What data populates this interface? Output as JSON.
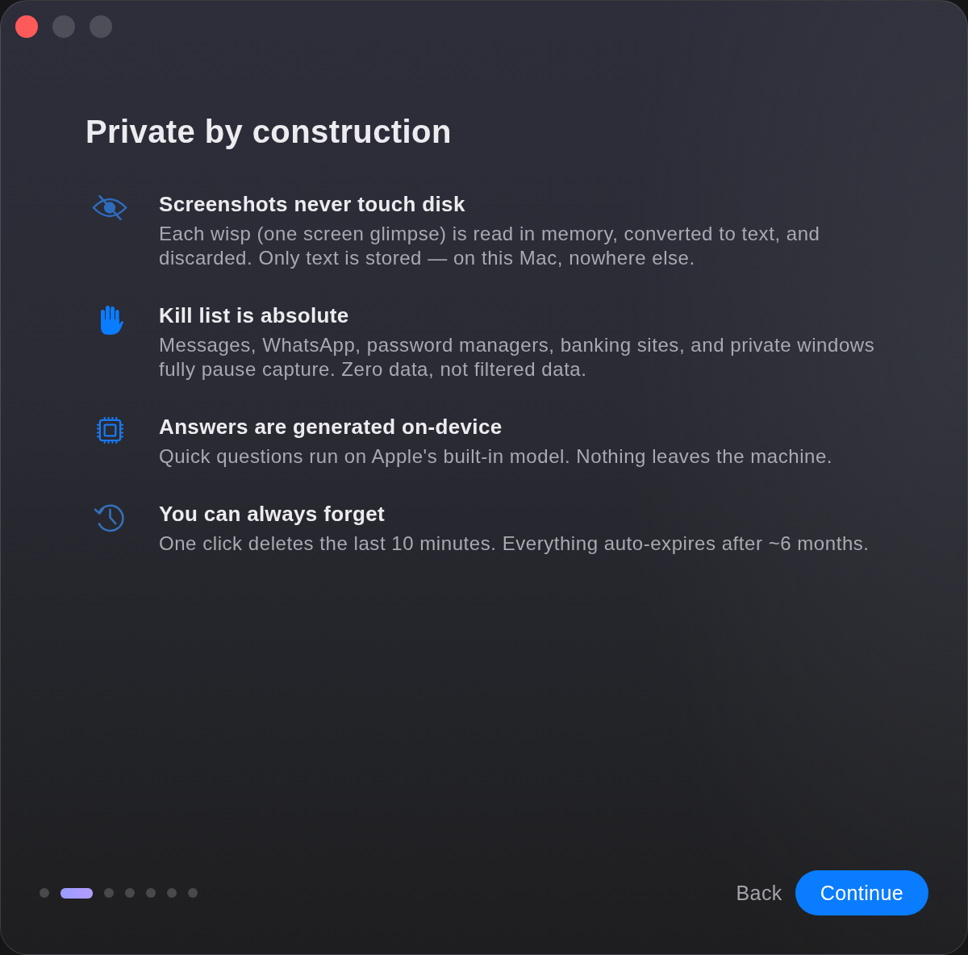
{
  "window": {
    "controls": [
      {
        "kind": "close",
        "enabled": true
      },
      {
        "kind": "minimize",
        "enabled": false
      },
      {
        "kind": "zoom",
        "enabled": false
      }
    ]
  },
  "title": "Private by construction",
  "features": [
    {
      "kind": "capture",
      "title": "Screenshots never touch disk",
      "description": "Each wisp (one screen glimpse) is read in memory, converted to text, and discarded. Only text is stored — on this Mac, nowhere else."
    },
    {
      "kind": "block",
      "title": "Kill list is absolute",
      "description": "Messages, WhatsApp, password managers, banking sites, and private windows fully pause capture. Zero data, not filtered data."
    },
    {
      "kind": "device",
      "title": "Answers are generated on-device",
      "description": "Quick questions run on Apple's built-in model. Nothing leaves the machine."
    },
    {
      "kind": "expiry",
      "title": "You can always forget",
      "description": "One click deletes the last 10 minutes. Everything auto-expires after ~6 months."
    }
  ],
  "pager": {
    "dots": [
      {
        "selected": false
      },
      {
        "selected": true
      },
      {
        "selected": false
      },
      {
        "selected": false
      },
      {
        "selected": false
      },
      {
        "selected": false
      },
      {
        "selected": false
      }
    ]
  },
  "actions": [
    {
      "kind": "secondary",
      "label": "Back"
    },
    {
      "kind": "primary",
      "label": "Continue"
    }
  ]
}
